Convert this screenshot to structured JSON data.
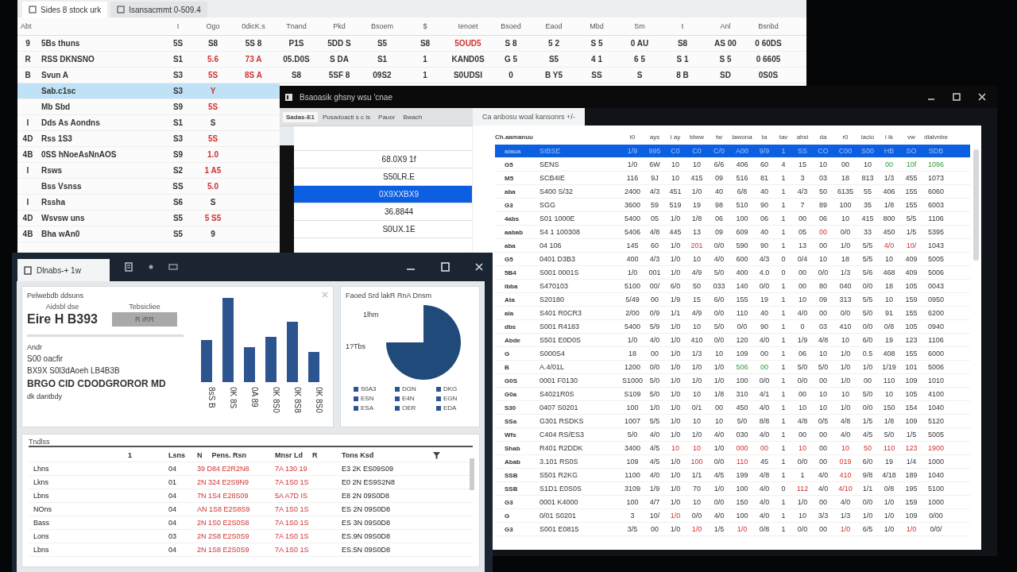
{
  "back_window": {
    "tabs": [
      {
        "label": "Sides 8 stock urk",
        "selected": true
      },
      {
        "label": "Isansacmmt 0-509.4",
        "selected": false
      }
    ],
    "label_column": "Abt",
    "columns": [
      "I",
      "Ogo",
      "0dicK.s",
      "Tnand",
      "Pkd",
      "Bsoem",
      "$",
      "Ienoet",
      "Bsoed",
      "Eaod",
      "Mbd",
      "Sm",
      "t",
      "Anl",
      "Bsnbd"
    ],
    "rows": [
      {
        "mark": "9",
        "name": "5Bs thuns",
        "selected": false,
        "cells": [
          "5S",
          "S8",
          "5S 8",
          "P1S",
          "5DD S",
          "S5",
          "S8",
          "5OUD5",
          "S 8",
          "5 2",
          "S 5",
          "0 AU",
          "S8",
          "AS 00",
          "0 60DS"
        ],
        "alerts": [
          false,
          false,
          false,
          false,
          false,
          false,
          false,
          true,
          false,
          false,
          false,
          false,
          false,
          false,
          false
        ]
      },
      {
        "mark": "R",
        "name": "RSS DKNSNO",
        "selected": false,
        "cells": [
          "S1",
          "5.6",
          "73 A",
          "05.D0S",
          "S DA",
          "S1",
          "1",
          "KAND0S",
          "G 5",
          "S5",
          "4 1",
          "6 5",
          "S 1",
          "S 5",
          "0 6605"
        ],
        "alerts": [
          false,
          true,
          true,
          false,
          false,
          false,
          false,
          false,
          false,
          false,
          false,
          false,
          false,
          false,
          false
        ]
      },
      {
        "mark": "B",
        "name": "Svun A",
        "selected": false,
        "cells": [
          "S3",
          "5S",
          "8S A",
          "S8",
          "5SF 8",
          "09S2",
          "1",
          "S0UDSI",
          "0",
          "B Y5",
          "SS",
          "S",
          "8 B",
          "SD",
          "0S0S"
        ],
        "alerts": [
          false,
          true,
          true,
          false,
          false,
          false,
          false,
          false,
          false,
          false,
          false,
          false,
          false,
          false,
          false
        ]
      },
      {
        "name": "Sab.c1sc",
        "selected": true,
        "cells": [
          "S3",
          "Y"
        ],
        "alerts": [
          false,
          true
        ]
      },
      {
        "name": "Mb Sbd",
        "selected": false,
        "cells": [
          "S9",
          "5S"
        ],
        "alerts": [
          false,
          true
        ]
      },
      {
        "mark": "I",
        "name": "Dds As Aondns",
        "selected": false,
        "cells": [
          "S1",
          "S"
        ],
        "alerts": [
          false,
          false
        ]
      },
      {
        "mark": "4D",
        "name": "Rss 1S3",
        "selected": false,
        "cells": [
          "S3",
          "5S"
        ],
        "alerts": [
          false,
          true
        ]
      },
      {
        "mark": "4B",
        "name": "0SS hNoeAsNnAOS",
        "selected": false,
        "cells": [
          "S9",
          "1.0"
        ],
        "alerts": [
          false,
          true
        ]
      },
      {
        "mark": "I",
        "name": "Rsws",
        "selected": false,
        "cells": [
          "S2",
          "1 A5"
        ],
        "alerts": [
          false,
          true
        ]
      },
      {
        "name": "Bss Vsnss",
        "selected": false,
        "cells": [
          "SS",
          "5.0"
        ],
        "alerts": [
          false,
          true
        ]
      },
      {
        "mark": "I",
        "name": "Rssha",
        "selected": false,
        "cells": [
          "S6",
          "S"
        ],
        "alerts": [
          false,
          false
        ]
      },
      {
        "mark": "4D",
        "name": "Wsvsw uns",
        "selected": false,
        "cells": [
          "S5",
          "5 S5"
        ],
        "alerts": [
          false,
          true
        ]
      },
      {
        "mark": "4B",
        "name": "Bha wAn0",
        "selected": false,
        "cells": [
          "S5",
          "9"
        ],
        "alerts": [
          false,
          false
        ]
      }
    ]
  },
  "main_window": {
    "title": "Bsaoasik ghsny wsu 'cnae",
    "tabs": [
      {
        "label": "Sadas-E1",
        "selected": true
      },
      {
        "label": "Pusadoacti s c ls",
        "selected": false
      },
      {
        "label": "Pauor",
        "selected": false
      },
      {
        "label": "Bwach",
        "selected": false
      }
    ],
    "list": [
      {
        "text": "68.0X9 1f",
        "selected": false
      },
      {
        "text": "S50LR.E",
        "selected": false
      },
      {
        "text": "0X9XXBX9",
        "selected": true
      },
      {
        "text": "36.8844",
        "selected": false
      },
      {
        "text": "S0UX.1E",
        "selected": false
      }
    ],
    "grid_tab": "Ca anbosu woal kansonrs +/-",
    "tree_heading": "Ch.aamanuu",
    "columns": [
      "t0",
      "ays",
      "i ay",
      "tdww",
      "tw",
      "lawona",
      "ta",
      "tav",
      "ahsi",
      "da",
      "r0",
      "iacio",
      "i ik",
      "vw",
      "dlalvnbe"
    ],
    "rows": [
      {
        "code": "aiaua",
        "name": "SIBSE",
        "selected": true,
        "cells": [
          "1/9",
          "995",
          "C0",
          "C0",
          "C/0",
          "A00",
          "9/9",
          "1",
          "SS",
          "CO",
          "C00",
          "S00",
          "HB",
          "SO",
          "SDB"
        ],
        "alerts": [
          false,
          false,
          false,
          false,
          false,
          false,
          false,
          false,
          false,
          false,
          false,
          false,
          false,
          false,
          false
        ],
        "up": [
          false,
          false,
          false,
          false,
          false,
          false,
          false,
          false,
          false,
          false,
          false,
          false,
          false,
          false,
          false
        ]
      },
      {
        "code": "G5",
        "name": "SENS",
        "selected": false,
        "cells": [
          "1/0",
          "6W",
          "10",
          "10",
          "6/6",
          "406",
          "60",
          "4",
          "15",
          "10",
          "00",
          "10",
          "00",
          "10f",
          "1096"
        ],
        "alerts": [
          false,
          false,
          false,
          false,
          false,
          false,
          false,
          false,
          false,
          false,
          false,
          false,
          false,
          false,
          false
        ],
        "up": [
          false,
          false,
          false,
          false,
          false,
          false,
          false,
          false,
          false,
          false,
          false,
          false,
          true,
          true,
          true
        ]
      },
      {
        "code": "M5",
        "name": "SCB4IE",
        "selected": false,
        "cells": [
          "116",
          "9J",
          "10",
          "415",
          "09",
          "516",
          "81",
          "1",
          "3",
          "03",
          "18",
          "813",
          "1/3",
          "455",
          "1073"
        ],
        "alerts": [
          false,
          false,
          false,
          false,
          false,
          false,
          false,
          false,
          false,
          false,
          false,
          false,
          false,
          false,
          false
        ],
        "up": [
          false,
          false,
          false,
          false,
          false,
          false,
          false,
          false,
          false,
          false,
          false,
          false,
          false,
          false,
          false
        ]
      },
      {
        "code": "aba",
        "name": "S400 S/32",
        "selected": false,
        "cells": [
          "2400",
          "4/3",
          "451",
          "1/0",
          "40",
          "6/8",
          "40",
          "1",
          "4/3",
          "50",
          "6135",
          "55",
          "406",
          "155",
          "6060"
        ],
        "alerts": [
          false,
          false,
          false,
          false,
          false,
          false,
          false,
          false,
          false,
          false,
          false,
          false,
          false,
          false,
          false
        ],
        "up": [
          false,
          false,
          false,
          false,
          false,
          false,
          false,
          false,
          false,
          false,
          false,
          false,
          false,
          false,
          false
        ]
      },
      {
        "code": "G3",
        "name": "SGG",
        "selected": false,
        "cells": [
          "3600",
          "59",
          "519",
          "19",
          "98",
          "510",
          "90",
          "1",
          "7",
          "89",
          "100",
          "35",
          "1/8",
          "155",
          "6003"
        ],
        "alerts": [
          false,
          false,
          false,
          false,
          false,
          false,
          false,
          false,
          false,
          false,
          false,
          false,
          false,
          false,
          false
        ],
        "up": [
          false,
          false,
          false,
          false,
          false,
          false,
          false,
          false,
          false,
          false,
          false,
          false,
          false,
          false,
          false
        ]
      },
      {
        "code": "4abs",
        "name": "S01 1000E",
        "selected": false,
        "cells": [
          "5400",
          "05",
          "1/0",
          "1/8",
          "06",
          "100",
          "06",
          "1",
          "00",
          "06",
          "10",
          "415",
          "800",
          "5/5",
          "1106"
        ],
        "alerts": [
          false,
          false,
          false,
          false,
          false,
          false,
          false,
          false,
          false,
          false,
          false,
          false,
          false,
          false,
          false
        ],
        "up": [
          false,
          false,
          false,
          false,
          false,
          false,
          false,
          false,
          false,
          false,
          false,
          false,
          false,
          false,
          false
        ]
      },
      {
        "code": "aabab",
        "name": "S4 1 100308",
        "selected": false,
        "cells": [
          "5406",
          "4/8",
          "445",
          "13",
          "09",
          "609",
          "40",
          "1",
          "05",
          "00",
          "0/0",
          "33",
          "450",
          "1/5",
          "5395"
        ],
        "alerts": [
          false,
          false,
          false,
          false,
          false,
          false,
          false,
          false,
          false,
          true,
          false,
          false,
          false,
          false,
          false
        ],
        "up": [
          false,
          false,
          false,
          false,
          false,
          false,
          false,
          false,
          false,
          false,
          false,
          false,
          false,
          false,
          false
        ]
      },
      {
        "code": "aba",
        "name": "04 106",
        "selected": false,
        "cells": [
          "145",
          "60",
          "1/0",
          "201",
          "0/0",
          "590",
          "90",
          "1",
          "13",
          "00",
          "1/0",
          "5/5",
          "4/0",
          "10/",
          "1043"
        ],
        "alerts": [
          false,
          false,
          false,
          true,
          false,
          false,
          false,
          false,
          false,
          false,
          false,
          false,
          true,
          true,
          false
        ],
        "up": [
          false,
          false,
          false,
          false,
          false,
          false,
          false,
          false,
          false,
          false,
          false,
          false,
          false,
          false,
          false
        ]
      },
      {
        "code": "G5",
        "name": "0401 D3B3",
        "selected": false,
        "cells": [
          "400",
          "4/3",
          "1/0",
          "10",
          "4/0",
          "600",
          "4/3",
          "0",
          "0/4",
          "10",
          "18",
          "5/5",
          "10",
          "409",
          "5005"
        ],
        "alerts": [
          false,
          false,
          false,
          false,
          false,
          false,
          false,
          false,
          false,
          false,
          false,
          false,
          false,
          false,
          false
        ],
        "up": [
          false,
          false,
          false,
          false,
          false,
          false,
          false,
          false,
          false,
          false,
          false,
          false,
          false,
          false,
          false
        ]
      },
      {
        "code": "5B4",
        "name": "S001 0001S",
        "selected": false,
        "cells": [
          "1/0",
          "001",
          "1/0",
          "4/9",
          "5/0",
          "400",
          "4.0",
          "0",
          "00",
          "0/0",
          "1/3",
          "5/6",
          "468",
          "409",
          "5006"
        ],
        "alerts": [
          false,
          false,
          false,
          false,
          false,
          false,
          false,
          false,
          false,
          false,
          false,
          false,
          false,
          false,
          false
        ],
        "up": [
          false,
          false,
          false,
          false,
          false,
          false,
          false,
          false,
          false,
          false,
          false,
          false,
          false,
          false,
          false
        ]
      },
      {
        "code": "ibba",
        "name": "S470103",
        "selected": false,
        "cells": [
          "5100",
          "00/",
          "6/0",
          "50",
          "033",
          "140",
          "0/0",
          "1",
          "00",
          "80",
          "040",
          "0/0",
          "18",
          "105",
          "0043"
        ],
        "alerts": [
          false,
          false,
          false,
          false,
          false,
          false,
          false,
          false,
          false,
          false,
          false,
          false,
          false,
          false,
          false
        ],
        "up": [
          false,
          false,
          false,
          false,
          false,
          false,
          false,
          false,
          false,
          false,
          false,
          false,
          false,
          false,
          false
        ]
      },
      {
        "code": "Ata",
        "name": "S20180",
        "selected": false,
        "cells": [
          "5/49",
          "00",
          "1/9",
          "15",
          "6/0",
          "155",
          "19",
          "1",
          "10",
          "09",
          "313",
          "5/5",
          "10",
          "159",
          "0950"
        ],
        "alerts": [
          false,
          false,
          false,
          false,
          false,
          false,
          false,
          false,
          false,
          false,
          false,
          false,
          false,
          false,
          false
        ],
        "up": [
          false,
          false,
          false,
          false,
          false,
          false,
          false,
          false,
          false,
          false,
          false,
          false,
          false,
          false,
          false
        ]
      },
      {
        "code": "ala",
        "name": "S401 R0CR3",
        "selected": false,
        "cells": [
          "2/00",
          "0/9",
          "1/1",
          "4/9",
          "0/0",
          "110",
          "40",
          "1",
          "4/0",
          "00",
          "0/0",
          "5/0",
          "91",
          "155",
          "6200"
        ],
        "alerts": [
          false,
          false,
          false,
          false,
          false,
          false,
          false,
          false,
          false,
          false,
          false,
          false,
          false,
          false,
          false
        ],
        "up": [
          false,
          false,
          false,
          false,
          false,
          false,
          false,
          false,
          false,
          false,
          false,
          false,
          false,
          false,
          false
        ]
      },
      {
        "code": "dbs",
        "name": "S001 R4183",
        "selected": false,
        "cells": [
          "5400",
          "5/9",
          "1/0",
          "10",
          "5/0",
          "0/0",
          "90",
          "1",
          "0",
          "03",
          "410",
          "0/0",
          "0/8",
          "105",
          "0940"
        ],
        "alerts": [
          false,
          false,
          false,
          false,
          false,
          false,
          false,
          false,
          false,
          false,
          false,
          false,
          false,
          false,
          false
        ],
        "up": [
          false,
          false,
          false,
          false,
          false,
          false,
          false,
          false,
          false,
          false,
          false,
          false,
          false,
          false,
          false
        ]
      },
      {
        "code": "Abde",
        "name": "S501 E0D0S",
        "selected": false,
        "cells": [
          "1/0",
          "4/0",
          "1/0",
          "410",
          "0/0",
          "120",
          "4/0",
          "1",
          "1/9",
          "4/8",
          "10",
          "6/0",
          "19",
          "123",
          "1106"
        ],
        "alerts": [
          false,
          false,
          false,
          false,
          false,
          false,
          false,
          false,
          false,
          false,
          false,
          false,
          false,
          false,
          false
        ],
        "up": [
          false,
          false,
          false,
          false,
          false,
          false,
          false,
          false,
          false,
          false,
          false,
          false,
          false,
          false,
          false
        ]
      },
      {
        "code": "G",
        "name": "S000S4",
        "selected": false,
        "cells": [
          "18",
          "00",
          "1/0",
          "1/3",
          "10",
          "109",
          "00",
          "1",
          "06",
          "10",
          "1/0",
          "0.5",
          "408",
          "155",
          "6000"
        ],
        "alerts": [
          false,
          false,
          false,
          false,
          false,
          false,
          false,
          false,
          false,
          false,
          false,
          false,
          false,
          false,
          false
        ],
        "up": [
          false,
          false,
          false,
          false,
          false,
          false,
          false,
          false,
          false,
          false,
          false,
          false,
          false,
          false,
          false
        ]
      },
      {
        "code": "B",
        "name": "A.4/01L",
        "selected": false,
        "cells": [
          "1200",
          "0/0",
          "1/0",
          "1/0",
          "1/0",
          "506",
          "00",
          "1",
          "5/0",
          "5/0",
          "1/0",
          "1/0",
          "1/19",
          "101",
          "5006"
        ],
        "alerts": [
          false,
          false,
          false,
          false,
          false,
          false,
          false,
          false,
          false,
          false,
          false,
          false,
          false,
          false,
          false
        ],
        "up": [
          false,
          false,
          false,
          false,
          false,
          true,
          true,
          false,
          false,
          false,
          false,
          false,
          false,
          false,
          false
        ]
      },
      {
        "code": "G0S",
        "name": "0001 F0130",
        "selected": false,
        "cells": [
          "S1000",
          "5/0",
          "1/0",
          "1/0",
          "1/0",
          "100",
          "0/0",
          "1",
          "0/0",
          "00",
          "1/0",
          "00",
          "110",
          "109",
          "1010"
        ],
        "alerts": [
          false,
          false,
          false,
          false,
          false,
          false,
          false,
          false,
          false,
          false,
          false,
          false,
          false,
          false,
          false
        ],
        "up": [
          false,
          false,
          false,
          false,
          false,
          false,
          false,
          false,
          false,
          false,
          false,
          false,
          false,
          false,
          false
        ]
      },
      {
        "code": "G0a",
        "name": "S4021R0S",
        "selected": false,
        "cells": [
          "S109",
          "5/0",
          "1/0",
          "10",
          "1/8",
          "310",
          "4/1",
          "1",
          "00",
          "10",
          "10",
          "5/0",
          "10",
          "105",
          "4100"
        ],
        "alerts": [
          false,
          false,
          false,
          false,
          false,
          false,
          false,
          false,
          false,
          false,
          false,
          false,
          false,
          false,
          false
        ],
        "up": [
          false,
          false,
          false,
          false,
          false,
          false,
          false,
          false,
          false,
          false,
          false,
          false,
          false,
          false,
          false
        ]
      },
      {
        "code": "S30",
        "name": "0407 S0201",
        "selected": false,
        "cells": [
          "100",
          "1/0",
          "1/0",
          "0/1",
          "00",
          "450",
          "4/0",
          "1",
          "10",
          "10",
          "1/0",
          "0/0",
          "150",
          "154",
          "1040"
        ],
        "alerts": [
          false,
          false,
          false,
          false,
          false,
          false,
          false,
          false,
          false,
          false,
          false,
          false,
          false,
          false,
          false
        ],
        "up": [
          false,
          false,
          false,
          false,
          false,
          false,
          false,
          false,
          false,
          false,
          false,
          false,
          false,
          false,
          false
        ]
      },
      {
        "code": "SSa",
        "name": "G301 RSDKS",
        "selected": false,
        "cells": [
          "1007",
          "5/5",
          "1/0",
          "10",
          "10",
          "5/0",
          "8/8",
          "1",
          "4/8",
          "0/5",
          "4/8",
          "1/5",
          "1/8",
          "109",
          "5120"
        ],
        "alerts": [
          false,
          false,
          false,
          false,
          false,
          false,
          false,
          false,
          false,
          false,
          false,
          false,
          false,
          false,
          false
        ],
        "up": [
          false,
          false,
          false,
          false,
          false,
          false,
          false,
          false,
          false,
          false,
          false,
          false,
          false,
          false,
          false
        ]
      },
      {
        "code": "Wfs",
        "name": "C404 RS/ES3",
        "selected": false,
        "cells": [
          "5/0",
          "4/0",
          "1/0",
          "1/0",
          "4/0",
          "030",
          "4/0",
          "1",
          "00",
          "00",
          "4/0",
          "4/5",
          "5/0",
          "1/5",
          "5005"
        ],
        "alerts": [
          false,
          false,
          false,
          false,
          false,
          false,
          false,
          false,
          false,
          false,
          false,
          false,
          false,
          false,
          false
        ],
        "up": [
          false,
          false,
          false,
          false,
          false,
          false,
          false,
          false,
          false,
          false,
          false,
          false,
          false,
          false,
          false
        ]
      },
      {
        "code": "Shab",
        "name": "R401 R2DDK",
        "selected": false,
        "cells": [
          "3400",
          "4/5",
          "10",
          "10",
          "1/0",
          "000",
          "00",
          "1",
          "10",
          "00",
          "10",
          "50",
          "110",
          "123",
          "1900"
        ],
        "alerts": [
          false,
          false,
          true,
          true,
          false,
          true,
          true,
          false,
          true,
          false,
          true,
          true,
          true,
          true,
          true
        ],
        "up": [
          false,
          false,
          false,
          false,
          false,
          false,
          false,
          false,
          false,
          false,
          false,
          false,
          false,
          false,
          false
        ]
      },
      {
        "code": "Abab",
        "name": "3.101 RS0S",
        "selected": false,
        "cells": [
          "109",
          "4/5",
          "1/0",
          "100",
          "0/0",
          "110",
          "45",
          "1",
          "0/0",
          "00",
          "019",
          "6/0",
          "19",
          "1/4",
          "1000"
        ],
        "alerts": [
          false,
          false,
          false,
          true,
          false,
          true,
          false,
          false,
          false,
          false,
          true,
          false,
          false,
          false,
          false
        ],
        "up": [
          false,
          false,
          false,
          false,
          false,
          false,
          false,
          false,
          false,
          false,
          false,
          false,
          false,
          false,
          false
        ]
      },
      {
        "code": "SSB",
        "name": "S501 R2KG",
        "selected": false,
        "cells": [
          "1100",
          "4/0",
          "1/0",
          "1/1",
          "4/5",
          "199",
          "4/8",
          "1",
          "1",
          "4/0",
          "410",
          "9/8",
          "4/18",
          "189",
          "1040"
        ],
        "alerts": [
          false,
          false,
          false,
          false,
          false,
          false,
          false,
          false,
          false,
          false,
          true,
          false,
          false,
          false,
          false
        ],
        "up": [
          false,
          false,
          false,
          false,
          false,
          false,
          false,
          false,
          false,
          false,
          false,
          false,
          false,
          false,
          false
        ]
      },
      {
        "code": "SSB",
        "name": "S1D1 E0S0S",
        "selected": false,
        "cells": [
          "3109",
          "1/9",
          "1/0",
          "70",
          "1/0",
          "100",
          "4/0",
          "0",
          "112",
          "4/0",
          "4/10",
          "1/1",
          "0/8",
          "195",
          "5100"
        ],
        "alerts": [
          false,
          false,
          false,
          false,
          false,
          false,
          false,
          false,
          true,
          false,
          true,
          false,
          false,
          false,
          false
        ],
        "up": [
          false,
          false,
          false,
          false,
          false,
          false,
          false,
          false,
          false,
          false,
          false,
          false,
          false,
          false,
          false
        ]
      },
      {
        "code": "G3",
        "name": "0001 K4000",
        "selected": false,
        "cells": [
          "100",
          "4/7",
          "1/0",
          "10",
          "0/0",
          "150",
          "4/0",
          "1",
          "1/0",
          "00",
          "4/0",
          "0/0",
          "1/0",
          "159",
          "1000"
        ],
        "alerts": [
          false,
          false,
          false,
          false,
          false,
          false,
          false,
          false,
          false,
          false,
          false,
          false,
          false,
          false,
          false
        ],
        "up": [
          false,
          false,
          false,
          false,
          false,
          false,
          false,
          false,
          false,
          false,
          false,
          false,
          false,
          false,
          false
        ]
      },
      {
        "code": "G",
        "name": "0/01 S0201",
        "selected": false,
        "cells": [
          "3",
          "10/",
          "1/0",
          "0/0",
          "4/0",
          "100",
          "4/0",
          "1",
          "10",
          "3/3",
          "1/3",
          "1/0",
          "1/0",
          "109",
          "0/00"
        ],
        "alerts": [
          false,
          false,
          true,
          false,
          false,
          false,
          false,
          false,
          false,
          false,
          false,
          false,
          false,
          false,
          false
        ],
        "up": [
          false,
          false,
          false,
          false,
          false,
          false,
          false,
          false,
          false,
          false,
          false,
          false,
          false,
          false,
          false
        ]
      },
      {
        "code": "G3",
        "name": "S001 E0815",
        "selected": false,
        "cells": [
          "3/5",
          "00",
          "1/0",
          "1/0",
          "1/5",
          "1/0",
          "0/8",
          "1",
          "0/0",
          "00",
          "1/0",
          "6/5",
          "1/0",
          "1/0",
          "0/0/"
        ],
        "alerts": [
          false,
          false,
          false,
          true,
          false,
          true,
          false,
          false,
          false,
          false,
          true,
          false,
          false,
          true,
          false
        ],
        "up": [
          false,
          false,
          false,
          false,
          false,
          false,
          false,
          false,
          false,
          false,
          false,
          false,
          false,
          false,
          false
        ]
      }
    ]
  },
  "dashboard_window": {
    "tab": "Dlnabs-+ 1w",
    "summary": {
      "title": "Pelwebdb ddsuns",
      "value_label": "Aidsbl dse",
      "value": "Eire H B393",
      "action_label": "Tebsicliee",
      "action": "R iRR",
      "lines": [
        {
          "text": "Andr",
          "kind": "small"
        },
        {
          "text": "S00 oacfir",
          "kind": "plain"
        },
        {
          "text": "BX9X S0l3dAoeh LB4B3B",
          "kind": "plain"
        },
        {
          "text": "BRGO CID CDODGROROR MD",
          "kind": "big"
        },
        {
          "text": "dk dantbdy",
          "kind": "small"
        }
      ]
    },
    "bar_labels": [
      "8sS B",
      "0K 8S",
      "0A 89",
      "0K 8S0",
      "0K 8S8",
      "0K 8S0"
    ],
    "pie": {
      "title": "Faoed Srd lakR RnA Dnsm",
      "callouts": [
        "1lhm",
        "1?Tbs"
      ],
      "legend": [
        "S0A3",
        "DGN",
        "DKG",
        "ESN",
        "E4N",
        "EGN",
        "ESA",
        "OER",
        "EDA"
      ]
    },
    "table": {
      "title": "Tndlss",
      "name_column": "1",
      "columns": [
        {
          "label": "Lsns"
        },
        {
          "before": "N",
          "label": "Pens. Rsn"
        },
        {
          "label": "Mnsr Ld",
          "after": "R"
        },
        {
          "label": "Tons Ksd"
        }
      ],
      "rows": [
        {
          "name": "Lhns",
          "cells": [
            "04",
            "39 D84 E2R2N8",
            "7A 130 19",
            "E3 2K ES09S09"
          ],
          "alerts": [
            false,
            true,
            true,
            false
          ]
        },
        {
          "name": "Lkns",
          "cells": [
            "01",
            "2N 324 E2S9N9",
            "7A 1S0 1S",
            "E0 2N ES9S2N8"
          ],
          "alerts": [
            false,
            true,
            true,
            false
          ]
        },
        {
          "name": "Lbns",
          "cells": [
            "04",
            "7N 1S4 E28S09",
            "5A A7D IS",
            "E8 2N 09S0D8"
          ],
          "alerts": [
            false,
            true,
            true,
            false
          ]
        },
        {
          "name": "NOns",
          "cells": [
            "04",
            "AN 1S8 E2S8S9",
            "7A 1S0 1S",
            "ES 2N 09S0D8"
          ],
          "alerts": [
            false,
            true,
            true,
            false
          ]
        },
        {
          "name": "Bass",
          "cells": [
            "04",
            "2N 1S0 E2S0S8",
            "7A 1S0 1S",
            "ES 3N 09S0D8"
          ],
          "alerts": [
            false,
            true,
            true,
            false
          ]
        },
        {
          "name": "Lons",
          "cells": [
            "03",
            "2N 2S8 E2S0S9",
            "7A 1S0 1S",
            "ES.9N 09S0D8"
          ],
          "alerts": [
            false,
            true,
            true,
            false
          ]
        },
        {
          "name": "Lbns",
          "cells": [
            "04",
            "2N 1S8 E2S0S9",
            "7A 1S0 1S",
            "ES.5N 09S0D8"
          ],
          "alerts": [
            false,
            true,
            true,
            false
          ]
        }
      ]
    }
  }
}
